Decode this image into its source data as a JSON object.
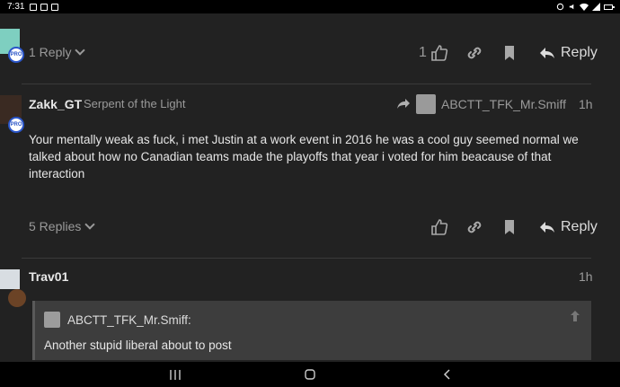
{
  "statusbar": {
    "time": "7:31"
  },
  "post_top": {
    "replies_label": "1 Reply",
    "like_count": "1",
    "reply_label": "Reply"
  },
  "post_zakk": {
    "username": "Zakk_GT",
    "user_title": "Serpent of the Light",
    "reply_to_user": "ABCTT_TFK_Mr.Smiff",
    "time": "1h",
    "badge": "PRO",
    "body": "Your mentally weak as fuck, i met Justin at a work event in 2016 he was a cool guy seemed normal we talked about how no Canadian teams made the playoffs that year i voted for him beacause of that interaction",
    "replies_label": "5 Replies",
    "reply_label": "Reply"
  },
  "post_trav": {
    "username": "Trav01",
    "time": "1h",
    "quote": {
      "author": "ABCTT_TFK_Mr.Smiff:",
      "text": "Another stupid liberal about to post"
    }
  },
  "top_badge": "PRO",
  "colors": {
    "background": "#222222",
    "accent_badge": "#2a55c8",
    "quote_bg": "#3d3d3d"
  }
}
